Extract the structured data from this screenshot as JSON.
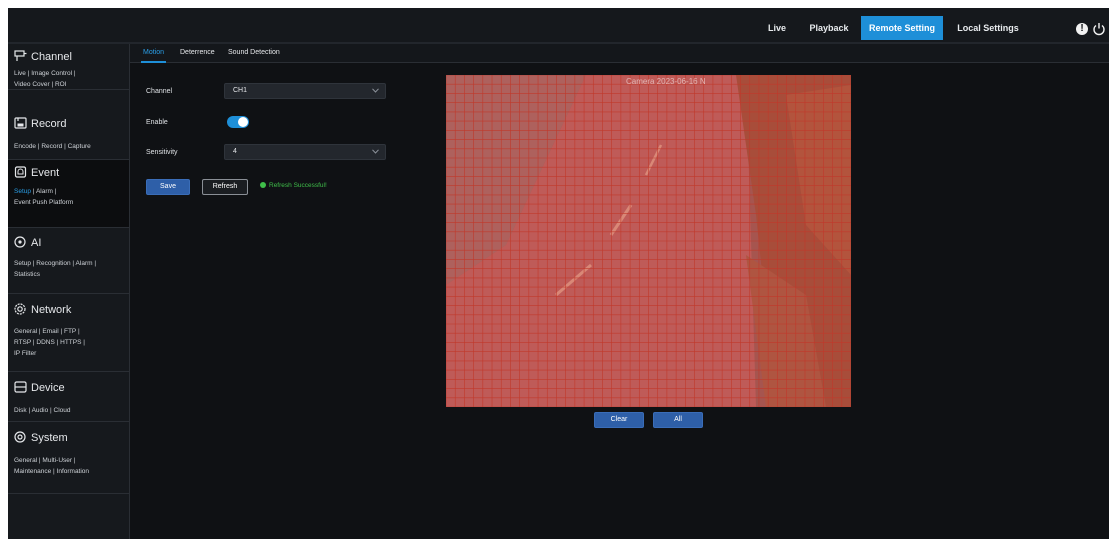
{
  "topbar": {
    "tabs": {
      "live": "Live",
      "playback": "Playback",
      "remote_setting": "Remote Setting",
      "local_settings": "Local Settings"
    },
    "alert_glyph": "!",
    "icons": [
      "alert-icon",
      "power-icon"
    ],
    "active_color": "#1e8fd8"
  },
  "sidebar": {
    "channel": {
      "title": "Channel",
      "links": [
        "Live | Image Control |",
        "Video Cover | ROI"
      ]
    },
    "record": {
      "title": "Record",
      "links": [
        "Encode | Record | Capture"
      ]
    },
    "event": {
      "title": "Event",
      "links_active": "Setup",
      "links_rest": " | Alarm |",
      "links_line2": "Event Push Platform"
    },
    "ai": {
      "title": "AI",
      "links": [
        "Setup | Recognition | Alarm |",
        "Statistics"
      ]
    },
    "network": {
      "title": "Network",
      "links": [
        "General | Email | FTP |",
        "RTSP | DDNS | HTTPS |",
        "IP Filter"
      ]
    },
    "device": {
      "title": "Device",
      "links": [
        "Disk | Audio | Cloud"
      ]
    },
    "system": {
      "title": "System",
      "links": [
        "General | Multi-User |",
        "Maintenance | Information"
      ]
    }
  },
  "subtabs": {
    "motion": "Motion",
    "deterrence": "Deterrence",
    "sound_detection": "Sound Detection"
  },
  "form": {
    "channel_label": "Channel",
    "channel_value": "CH1",
    "enable_label": "Enable",
    "enable_on": true,
    "sensitivity_label": "Sensitivity",
    "sensitivity_value": "4"
  },
  "buttons": {
    "save": "Save",
    "refresh": "Refresh",
    "refresh_status": "Refresh Successful!",
    "clear": "Clear",
    "all": "All"
  },
  "camera": {
    "overlay_text": "Camera    2023-06-16 N",
    "grid_color": "#c0392b",
    "detection_fill": "rgba(200,60,60,0.45)"
  }
}
